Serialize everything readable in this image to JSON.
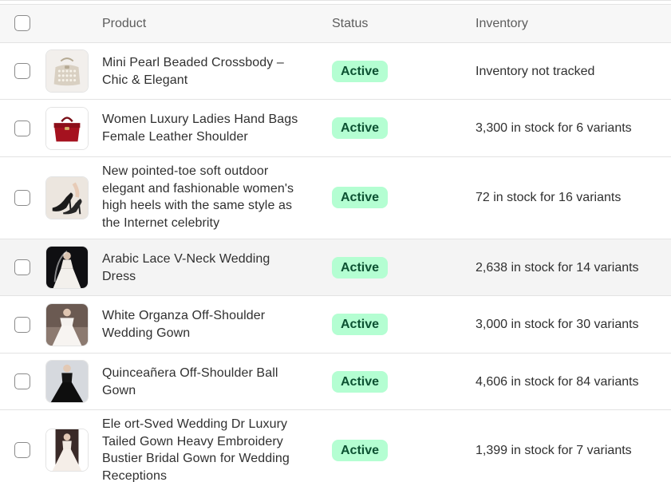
{
  "header": {
    "product_label": "Product",
    "status_label": "Status",
    "inventory_label": "Inventory"
  },
  "rows": [
    {
      "title_lines": [
        "Mini Pearl Beaded Crossbody –",
        "Chic & Elegant"
      ],
      "status": "Active",
      "inventory": "Inventory not tracked",
      "thumb_icon": "beaded-bag-thumbnail"
    },
    {
      "title_lines": [
        "Women Luxury Ladies Hand Bags",
        "Female Leather Shoulder"
      ],
      "status": "Active",
      "inventory": "3,300 in stock for 6 variants",
      "thumb_icon": "red-handbag-thumbnail"
    },
    {
      "title_lines": [
        "New pointed-toe soft outdoor",
        "elegant and fashionable women's",
        "high heels with the same style as",
        "the Internet celebrity"
      ],
      "status": "Active",
      "inventory": "72 in stock for 16 variants",
      "thumb_icon": "high-heels-thumbnail"
    },
    {
      "title_lines": [
        "Arabic Lace V-Neck Wedding",
        "Dress"
      ],
      "status": "Active",
      "inventory": "2,638 in stock for 14 variants",
      "thumb_icon": "wedding-dress-thumbnail"
    },
    {
      "title_lines": [
        "White Organza Off-Shoulder",
        "Wedding Gown"
      ],
      "status": "Active",
      "inventory": "3,000 in stock for 30 variants",
      "thumb_icon": "wedding-gown-thumbnail"
    },
    {
      "title_lines": [
        "Quinceañera Off-Shoulder Ball",
        "Gown"
      ],
      "status": "Active",
      "inventory": "4,606 in stock for 84 variants",
      "thumb_icon": "black-ball-gown-thumbnail"
    },
    {
      "title_lines": [
        "Ele ort-Sved Wedding Dr Luxury",
        "Tailed Gown Heavy Embroidery",
        "Bustier Bridal Gown for Wedding",
        "Receptions"
      ],
      "status": "Active",
      "inventory": "1,399 in stock for 7 variants",
      "thumb_icon": "bridal-gown-thumbnail"
    }
  ],
  "colors": {
    "badge_bg": "#b4fed2",
    "badge_text": "#0c5132",
    "header_bg": "#f7f7f7",
    "hover_row_bg": "#f4f4f4"
  }
}
